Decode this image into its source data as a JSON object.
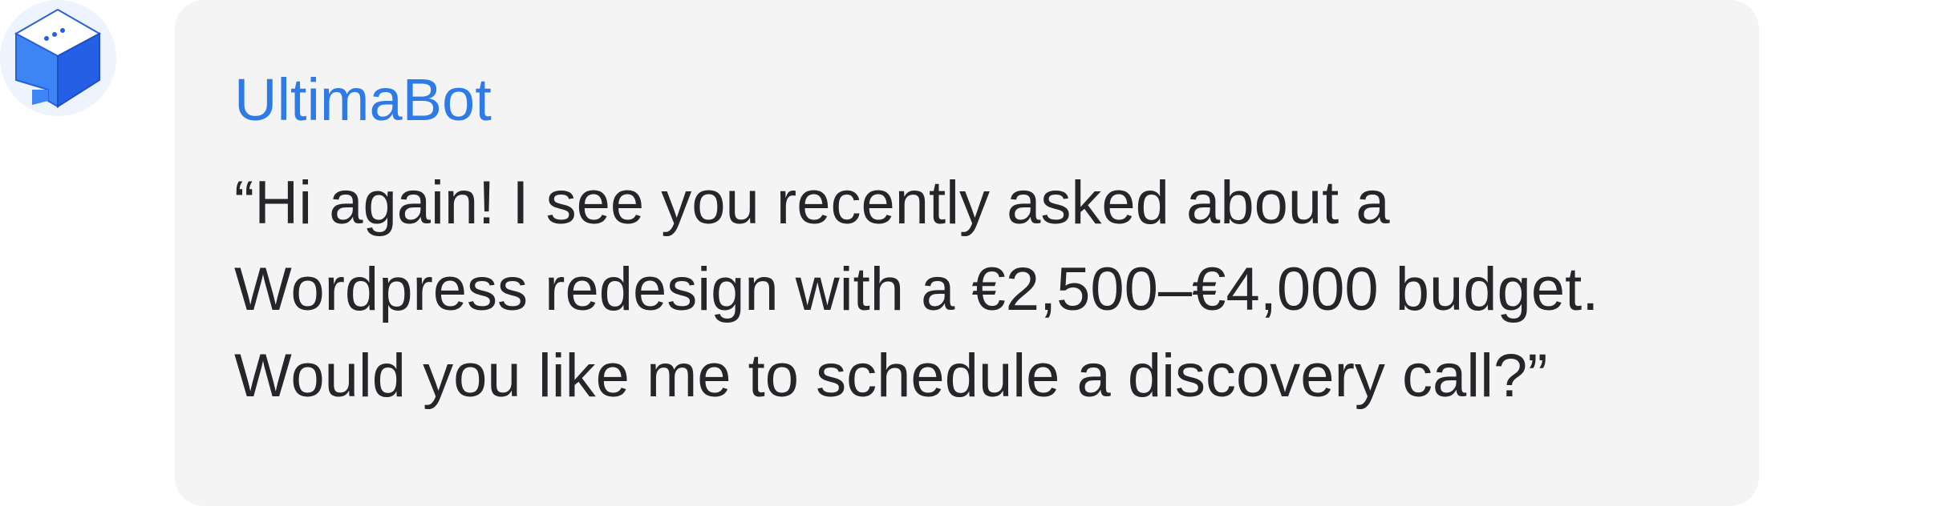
{
  "bot": {
    "name": "UltimaBot",
    "avatar_icon": "chat-cube-icon"
  },
  "message": {
    "lines": [
      "“Hi again! I see you recently asked about a",
      "Wordpress redesign with a €2,500–€4,000 budget.",
      "Would you like me to schedule a discovery call?”"
    ]
  },
  "colors": {
    "accent": "#2e7be8",
    "bubble_background": "#f4f4f4",
    "text": "#25252a",
    "avatar_background": "#eef4fd"
  }
}
